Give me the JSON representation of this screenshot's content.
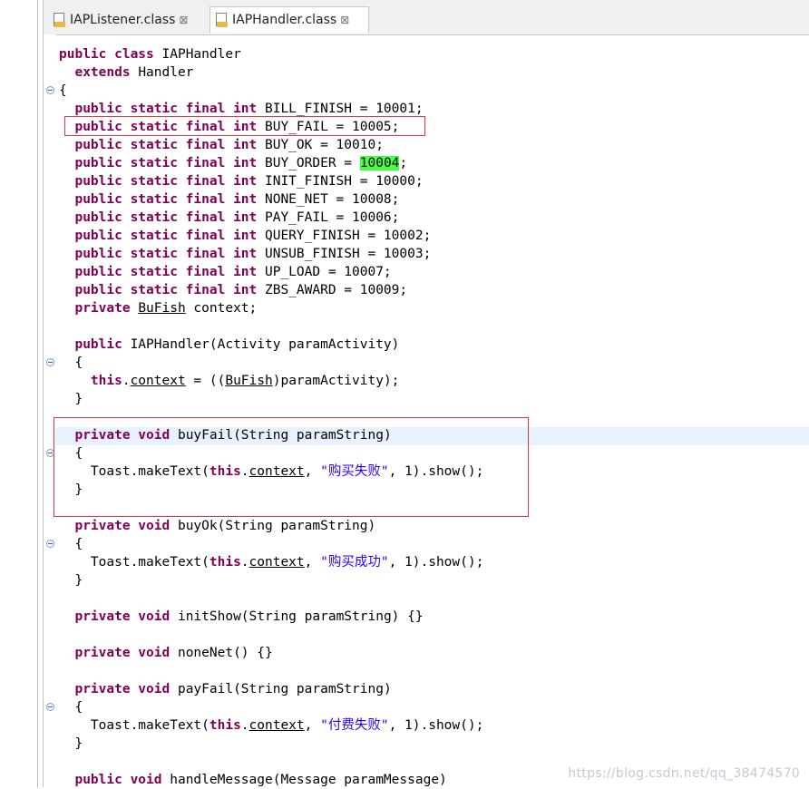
{
  "tabs": [
    {
      "label": "IAPListener.class",
      "close": "⊠"
    },
    {
      "label": "IAPHandler.class",
      "close": "⊠"
    }
  ],
  "code_lines": [
    [
      {
        "t": "public class ",
        "c": "kw"
      },
      {
        "t": "IAPHandler"
      }
    ],
    [
      {
        "t": "  "
      },
      {
        "t": "extends ",
        "c": "kw"
      },
      {
        "t": "Handler"
      }
    ],
    [
      {
        "t": "{"
      }
    ],
    [
      {
        "t": "  "
      },
      {
        "t": "public static final int ",
        "c": "kw"
      },
      {
        "t": "BILL_FINISH = 10001;"
      }
    ],
    [
      {
        "t": "  "
      },
      {
        "t": "public static final int ",
        "c": "kw"
      },
      {
        "t": "BUY_FAIL = 10005;"
      }
    ],
    [
      {
        "t": "  "
      },
      {
        "t": "public static final int ",
        "c": "kw"
      },
      {
        "t": "BUY_OK = 10010;"
      }
    ],
    [
      {
        "t": "  "
      },
      {
        "t": "public static final int ",
        "c": "kw"
      },
      {
        "t": "BUY_ORDER = "
      },
      {
        "t": "10004",
        "c": "hl"
      },
      {
        "t": ";"
      }
    ],
    [
      {
        "t": "  "
      },
      {
        "t": "public static final int ",
        "c": "kw"
      },
      {
        "t": "INIT_FINISH = 10000;"
      }
    ],
    [
      {
        "t": "  "
      },
      {
        "t": "public static final int ",
        "c": "kw"
      },
      {
        "t": "NONE_NET = 10008;"
      }
    ],
    [
      {
        "t": "  "
      },
      {
        "t": "public static final int ",
        "c": "kw"
      },
      {
        "t": "PAY_FAIL = 10006;"
      }
    ],
    [
      {
        "t": "  "
      },
      {
        "t": "public static final int ",
        "c": "kw"
      },
      {
        "t": "QUERY_FINISH = 10002;"
      }
    ],
    [
      {
        "t": "  "
      },
      {
        "t": "public static final int ",
        "c": "kw"
      },
      {
        "t": "UNSUB_FINISH = 10003;"
      }
    ],
    [
      {
        "t": "  "
      },
      {
        "t": "public static final int ",
        "c": "kw"
      },
      {
        "t": "UP_LOAD = 10007;"
      }
    ],
    [
      {
        "t": "  "
      },
      {
        "t": "public static final int ",
        "c": "kw"
      },
      {
        "t": "ZBS_AWARD = 10009;"
      }
    ],
    [
      {
        "t": "  "
      },
      {
        "t": "private ",
        "c": "kw"
      },
      {
        "t": "BuFish",
        "c": "ul"
      },
      {
        "t": " context;"
      }
    ],
    [
      {
        "t": ""
      }
    ],
    [
      {
        "t": "  "
      },
      {
        "t": "public ",
        "c": "kw"
      },
      {
        "t": "IAPHandler(Activity paramActivity)"
      }
    ],
    [
      {
        "t": "  {"
      }
    ],
    [
      {
        "t": "    "
      },
      {
        "t": "this",
        "c": "kw"
      },
      {
        "t": "."
      },
      {
        "t": "context",
        "c": "ul"
      },
      {
        "t": " = (("
      },
      {
        "t": "BuFish",
        "c": "ul"
      },
      {
        "t": ")paramActivity);"
      }
    ],
    [
      {
        "t": "  }"
      }
    ],
    [
      {
        "t": ""
      }
    ],
    [
      {
        "t": "  "
      },
      {
        "t": "private void ",
        "c": "kw"
      },
      {
        "t": "buyFail(String paramString)"
      }
    ],
    [
      {
        "t": "  {"
      }
    ],
    [
      {
        "t": "    Toast.makeText("
      },
      {
        "t": "this",
        "c": "kw"
      },
      {
        "t": "."
      },
      {
        "t": "context",
        "c": "ul"
      },
      {
        "t": ", "
      },
      {
        "t": "\"购买失败\"",
        "c": "str"
      },
      {
        "t": ", 1).show();"
      }
    ],
    [
      {
        "t": "  }"
      }
    ],
    [
      {
        "t": ""
      }
    ],
    [
      {
        "t": "  "
      },
      {
        "t": "private void ",
        "c": "kw"
      },
      {
        "t": "buyOk(String paramString)"
      }
    ],
    [
      {
        "t": "  {"
      }
    ],
    [
      {
        "t": "    Toast.makeText("
      },
      {
        "t": "this",
        "c": "kw"
      },
      {
        "t": "."
      },
      {
        "t": "context",
        "c": "ul"
      },
      {
        "t": ", "
      },
      {
        "t": "\"购买成功\"",
        "c": "str"
      },
      {
        "t": ", 1).show();"
      }
    ],
    [
      {
        "t": "  }"
      }
    ],
    [
      {
        "t": ""
      }
    ],
    [
      {
        "t": "  "
      },
      {
        "t": "private void ",
        "c": "kw"
      },
      {
        "t": "initShow(String paramString) {}"
      }
    ],
    [
      {
        "t": ""
      }
    ],
    [
      {
        "t": "  "
      },
      {
        "t": "private void ",
        "c": "kw"
      },
      {
        "t": "noneNet() {}"
      }
    ],
    [
      {
        "t": ""
      }
    ],
    [
      {
        "t": "  "
      },
      {
        "t": "private void ",
        "c": "kw"
      },
      {
        "t": "payFail(String paramString)"
      }
    ],
    [
      {
        "t": "  {"
      }
    ],
    [
      {
        "t": "    Toast.makeText("
      },
      {
        "t": "this",
        "c": "kw"
      },
      {
        "t": "."
      },
      {
        "t": "context",
        "c": "ul"
      },
      {
        "t": ", "
      },
      {
        "t": "\"付费失败\"",
        "c": "str"
      },
      {
        "t": ", 1).show();"
      }
    ],
    [
      {
        "t": "  }"
      }
    ],
    [
      {
        "t": ""
      }
    ],
    [
      {
        "t": "  "
      },
      {
        "t": "public void ",
        "c": "kw"
      },
      {
        "t": "handleMessage(Message paramMessage)"
      }
    ]
  ],
  "watermark": "https://blog.csdn.net/qq_38474570",
  "colors": {
    "keyword": "#7f0055",
    "string": "#2a00ff",
    "highlight": "#46ff46",
    "annotation": "#e0383e",
    "current_line": "#e8f2fe"
  }
}
